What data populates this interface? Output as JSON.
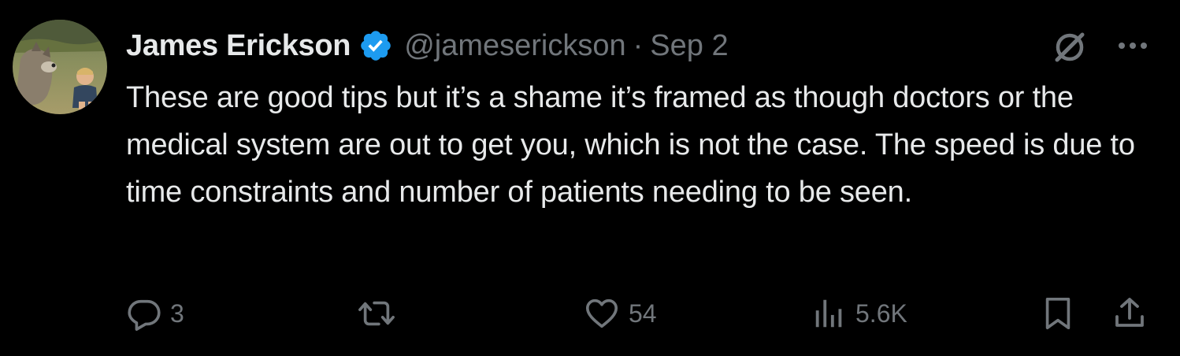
{
  "tweet": {
    "author_name": "James Erickson",
    "verified": true,
    "handle": "@jameserickson",
    "separator": "·",
    "date": "Sep 2",
    "text": "These are good tips but it’s a shame it’s framed as though doctors or the medical system are out to get you, which is not the case. The speed is due to time constraints and number of patients needing to be seen."
  },
  "actions": {
    "reply_count": "3",
    "repost_count": "",
    "like_count": "54",
    "views_count": "5.6K"
  },
  "icons": {
    "verified": "verified-badge-icon",
    "grok": "grok-icon",
    "more": "more-icon",
    "reply": "reply-icon",
    "repost": "repost-icon",
    "like": "heart-icon",
    "views": "views-icon",
    "bookmark": "bookmark-icon",
    "share": "share-icon"
  },
  "colors": {
    "background": "#000000",
    "text_primary": "#e7e9ea",
    "text_secondary": "#71767b",
    "verified_blue": "#1d9bf0"
  }
}
